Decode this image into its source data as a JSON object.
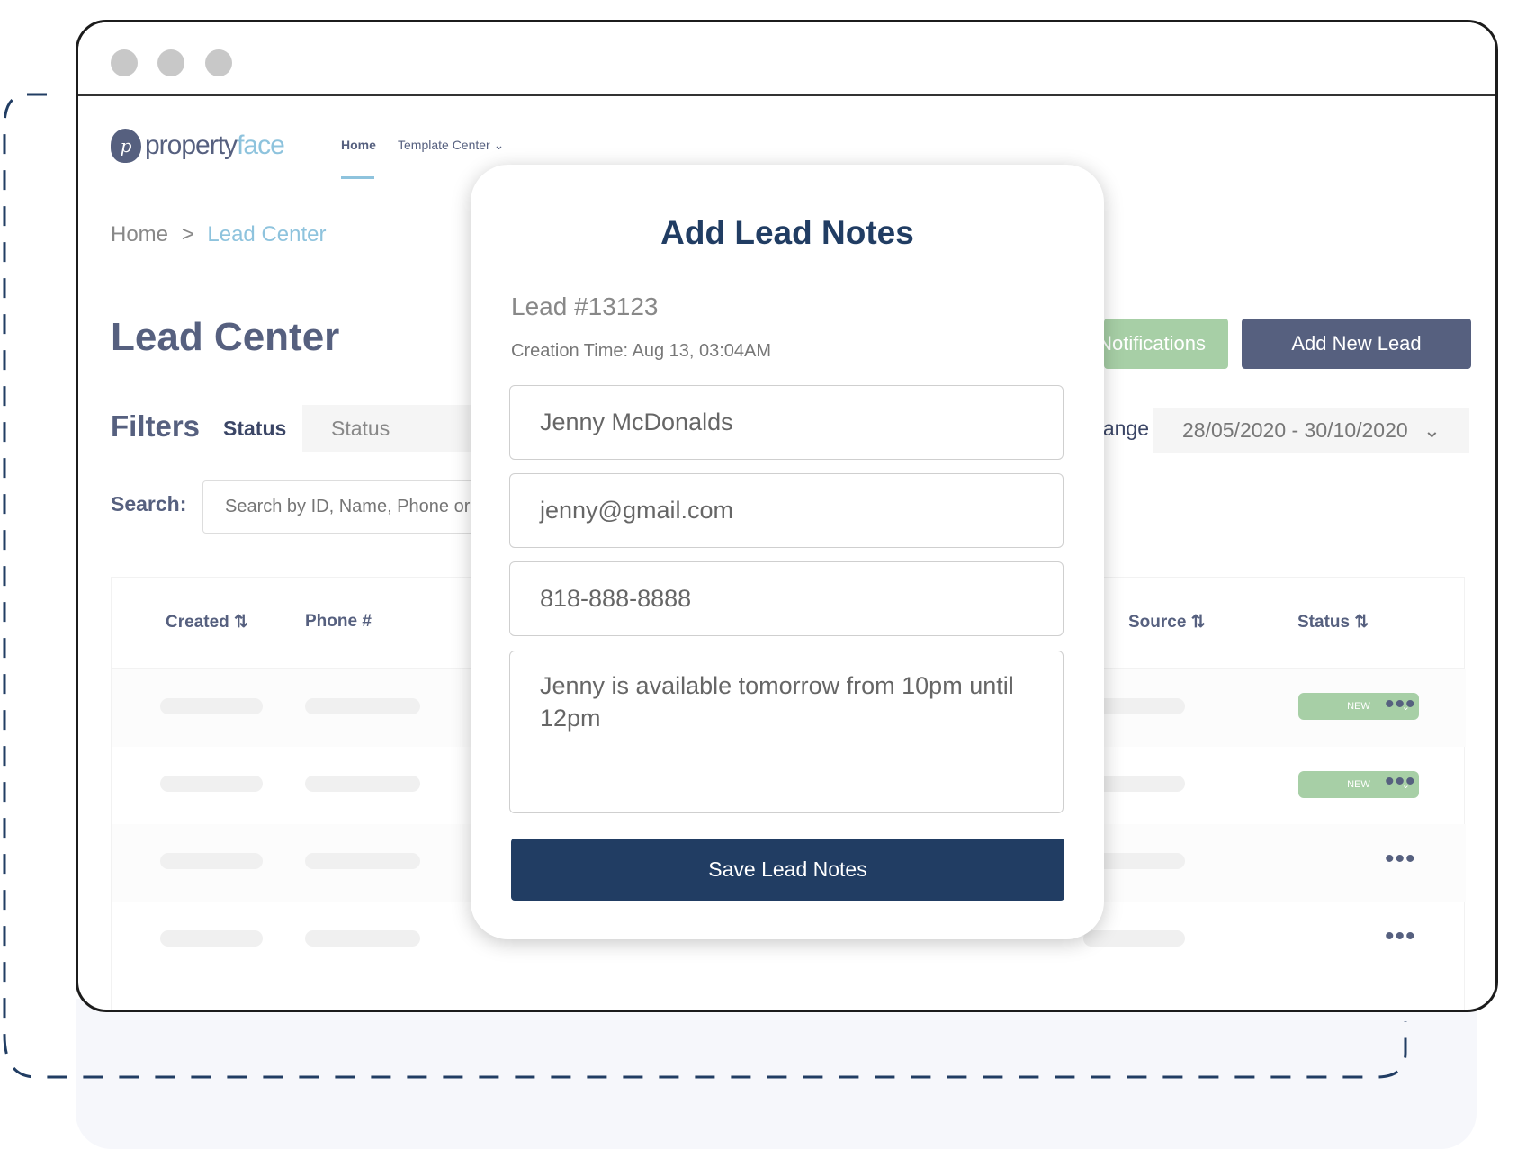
{
  "logo": {
    "mark": "p",
    "text_a": "property",
    "text_b": "face"
  },
  "nav": {
    "items": [
      {
        "label": "Home",
        "active": true
      },
      {
        "label": "Template Center",
        "dropdown": true
      }
    ]
  },
  "breadcrumb": {
    "home": "Home",
    "sep": ">",
    "current": "Lead Center"
  },
  "page": {
    "title": "Lead Center"
  },
  "buttons": {
    "notifications": "Notifications",
    "add_new_lead": "Add New Lead"
  },
  "filters": {
    "label": "Filters",
    "status_label": "Status",
    "status_placeholder": "Status",
    "date_label": "Date Range",
    "date_value": "28/05/2020 - 30/10/2020"
  },
  "search": {
    "label": "Search:",
    "placeholder": "Search by ID, Name, Phone or Email"
  },
  "table": {
    "headers": [
      "Created",
      "Phone #",
      "Source",
      "Status"
    ],
    "rows": [
      {
        "status": "NEW"
      },
      {
        "status": "NEW"
      },
      {
        "status": ""
      },
      {
        "status": ""
      }
    ]
  },
  "modal": {
    "title": "Add Lead Notes",
    "lead_id": "Lead #13123",
    "creation_time": "Creation Time: Aug 13, 03:04AM",
    "name": "Jenny McDonalds",
    "email": "jenny@gmail.com",
    "phone": "818-888-8888",
    "notes": "Jenny is available tomorrow from 10pm until 12pm",
    "save_label": "Save Lead Notes"
  },
  "colors": {
    "primary": "#213d63",
    "accent": "#8ec3dd",
    "green": "#a7cfa6",
    "slate": "#56607f"
  }
}
